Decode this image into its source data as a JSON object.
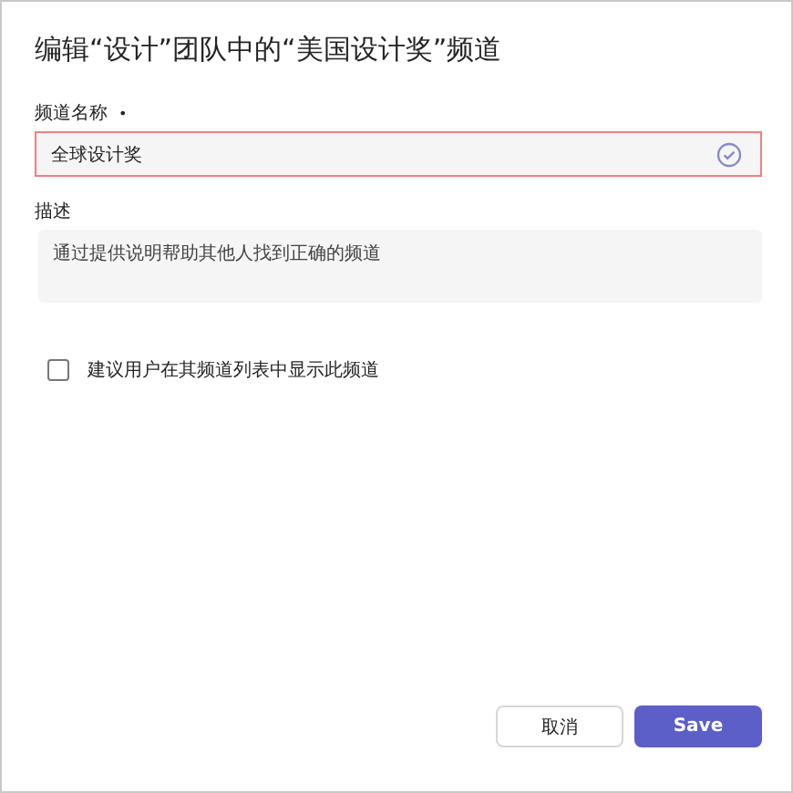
{
  "dialog": {
    "title": "编辑“设计”团队中的“美国设计奖”频道"
  },
  "name_field": {
    "label": "频道名称",
    "required_mark": "•",
    "value": "全球设计奖",
    "error": true,
    "valid": true
  },
  "description_field": {
    "label": "描述",
    "placeholder": "通过提供说明帮助其他人找到正确的频道"
  },
  "show_option": {
    "label": "建议用户在其频道列表中显示此频道",
    "checked": false
  },
  "buttons": [
    {
      "label": "取消",
      "kind": "secondary"
    },
    {
      "label": "Save",
      "kind": "primary"
    }
  ]
}
